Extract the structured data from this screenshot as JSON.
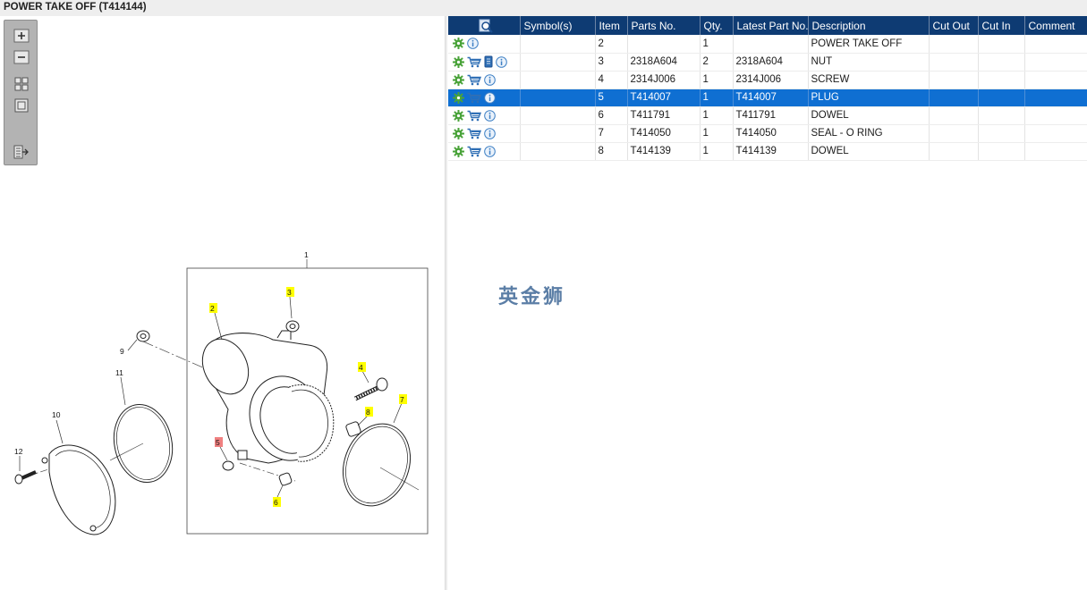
{
  "title": "POWER TAKE OFF (T414144)",
  "toolbar": {
    "buttons": [
      "zoom-in-icon",
      "zoom-out-icon",
      "fit-grid-icon",
      "actual-size-icon",
      "export-icon"
    ]
  },
  "diagram": {
    "callouts": [
      "1",
      "2",
      "3",
      "4",
      "5",
      "6",
      "7",
      "8",
      "9",
      "10",
      "11",
      "12"
    ],
    "highlight_yellow": "#ffff00",
    "highlight_red": "#f08080"
  },
  "table": {
    "headers": [
      "",
      "Symbol(s)",
      "Item",
      "Parts No.",
      "Qty.",
      "Latest Part No.",
      "Description",
      "Cut Out",
      "Cut In",
      "Comment"
    ],
    "rows": [
      {
        "item": "2",
        "parts_no": "",
        "qty": "1",
        "latest": "",
        "description": "POWER TAKE OFF",
        "cut_out": "",
        "cut_in": "",
        "comment": ""
      },
      {
        "item": "3",
        "parts_no": "2318A604",
        "qty": "2",
        "latest": "2318A604",
        "description": "NUT",
        "cut_out": "",
        "cut_in": "",
        "comment": ""
      },
      {
        "item": "4",
        "parts_no": "2314J006",
        "qty": "1",
        "latest": "2314J006",
        "description": "SCREW",
        "cut_out": "",
        "cut_in": "",
        "comment": ""
      },
      {
        "item": "5",
        "parts_no": "T414007",
        "qty": "1",
        "latest": "T414007",
        "description": "PLUG",
        "cut_out": "",
        "cut_in": "",
        "comment": ""
      },
      {
        "item": "6",
        "parts_no": "T411791",
        "qty": "1",
        "latest": "T411791",
        "description": "DOWEL",
        "cut_out": "",
        "cut_in": "",
        "comment": ""
      },
      {
        "item": "7",
        "parts_no": "T414050",
        "qty": "1",
        "latest": "T414050",
        "description": "SEAL - O RING",
        "cut_out": "",
        "cut_in": "",
        "comment": ""
      },
      {
        "item": "8",
        "parts_no": "T414139",
        "qty": "1",
        "latest": "T414139",
        "description": "DOWEL",
        "cut_out": "",
        "cut_in": "",
        "comment": ""
      }
    ],
    "selected_row_item": "5"
  },
  "watermark": "英金狮",
  "colors": {
    "header_bg": "#0e3b73",
    "selected_row": "#0f6fd2",
    "gear_icon": "#4aa33a",
    "cart_icon": "#2f6fb5",
    "info_icon": "#3d7fc4"
  }
}
